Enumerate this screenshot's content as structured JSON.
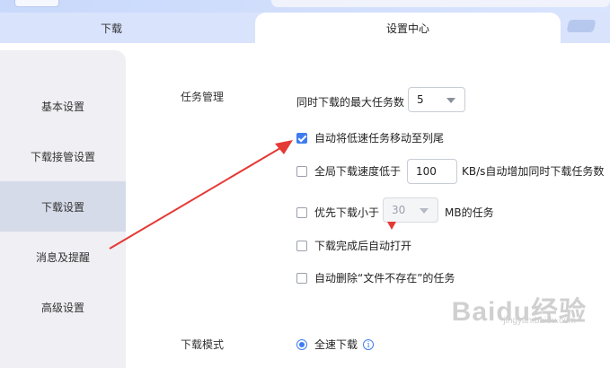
{
  "tabs": {
    "download": "下载",
    "settings_center": "设置中心"
  },
  "sidebar": {
    "items": [
      {
        "label": "基本设置"
      },
      {
        "label": "下载接管设置"
      },
      {
        "label": "下载设置",
        "active": true
      },
      {
        "label": "消息及提醒"
      },
      {
        "label": "高级设置"
      }
    ]
  },
  "task_management": {
    "title": "任务管理",
    "max_tasks_label": "同时下载的最大任务数",
    "max_tasks_value": "5",
    "move_slow_to_end": {
      "label": "自动将低速任务移动至列尾",
      "checked": true
    },
    "global_speed": {
      "label": "全局下载速度低于",
      "value": "100",
      "suffix": "KB/s自动增加同时下载任务数",
      "checked": false
    },
    "priority_small": {
      "label": "优先下载小于",
      "value": "30",
      "suffix": "MB的任务",
      "checked": false
    },
    "auto_open": {
      "label": "下载完成后自动打开",
      "checked": false
    },
    "auto_delete": {
      "label": "自动删除“文件不存在”的任务",
      "checked": false
    }
  },
  "download_mode": {
    "title": "下载模式",
    "full_speed": {
      "label": "全速下载",
      "selected": true
    }
  },
  "icons": {
    "info": "info-icon",
    "check": "check-icon",
    "dropdown": "chevron-down-icon"
  },
  "watermark": {
    "main": "Baidu经验",
    "sub": "jingyan.baidu.com"
  },
  "colors": {
    "accent": "#3d7cf0",
    "annotation_red": "#e53935",
    "sidebar_bg": "#efeff4",
    "sidebar_active": "#d6dbe9",
    "tabbar_bg": "#d9e3fc"
  }
}
